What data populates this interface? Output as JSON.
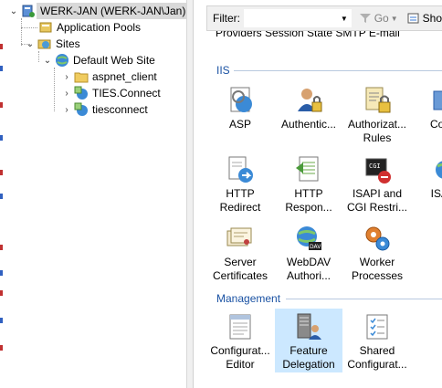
{
  "tree": {
    "server": "WERK-JAN (WERK-JAN\\Jan)",
    "app_pools": "Application Pools",
    "sites": "Sites",
    "default_site": "Default Web Site",
    "children": [
      "aspnet_client",
      "TIES.Connect",
      "tiesconnect"
    ]
  },
  "filter": {
    "label": "Filter:",
    "value": "",
    "go": "Go",
    "show": "Sho"
  },
  "content": {
    "cut_row": "Providers    Session State   SMTP E-mail",
    "iis_title": "IIS",
    "management_title": "Management",
    "iis_features": [
      {
        "label": "ASP",
        "icon": "asp-icon"
      },
      {
        "label": "Authentic...",
        "icon": "authentication-icon"
      },
      {
        "label": "Authorizat...\nRules",
        "icon": "authorization-rules-icon"
      },
      {
        "label": "Comp",
        "icon": "compression-icon"
      },
      {
        "label": "HTTP\nRedirect",
        "icon": "http-redirect-icon"
      },
      {
        "label": "HTTP\nRespon...",
        "icon": "http-response-icon"
      },
      {
        "label": "ISAPI and\nCGI Restri...",
        "icon": "isapi-cgi-icon"
      },
      {
        "label": "ISAPI",
        "icon": "isapi-filters-icon"
      },
      {
        "label": "Server\nCertificates",
        "icon": "server-certificates-icon"
      },
      {
        "label": "WebDAV\nAuthori...",
        "icon": "webdav-icon"
      },
      {
        "label": "Worker\nProcesses",
        "icon": "worker-processes-icon"
      }
    ],
    "management_features": [
      {
        "label": "Configurat...\nEditor",
        "icon": "configuration-editor-icon"
      },
      {
        "label": "Feature\nDelegation",
        "icon": "feature-delegation-icon",
        "selected": true
      },
      {
        "label": "Shared\nConfigurat...",
        "icon": "shared-configuration-icon"
      }
    ]
  },
  "colors": {
    "accent": "#1a52a3",
    "selection": "#cce8ff",
    "tree_selection": "#d9d9d9"
  }
}
